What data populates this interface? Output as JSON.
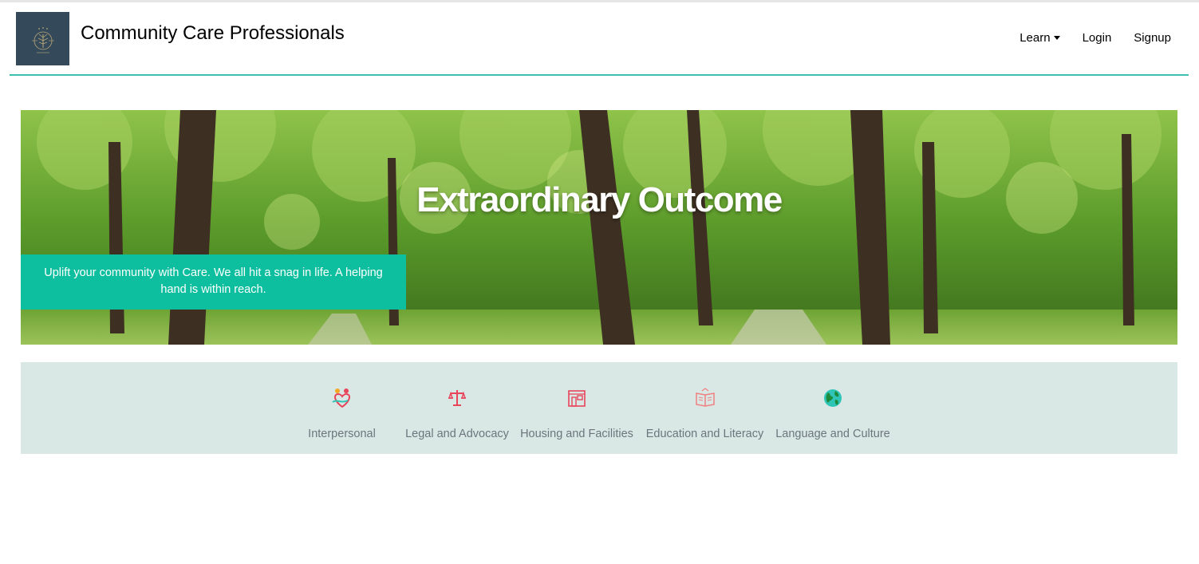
{
  "brand": {
    "name": "Community Care Professionals",
    "logo_icon": "tree-of-life-logo"
  },
  "nav": {
    "learn": "Learn",
    "login": "Login",
    "signup": "Signup"
  },
  "hero": {
    "title": "Extraordinary Outcome",
    "tagline": "Uplift your community with Care. We all hit a snag in life. A helping hand is within reach."
  },
  "categories": [
    {
      "label": "Interpersonal",
      "icon": "people-heart-icon"
    },
    {
      "label": "Legal and Advocacy",
      "icon": "scales-icon"
    },
    {
      "label": "Housing and Facilities",
      "icon": "house-icon"
    },
    {
      "label": "Education and Literacy",
      "icon": "open-book-icon"
    },
    {
      "label": "Language and Culture",
      "icon": "globe-icon"
    }
  ],
  "colors": {
    "accent": "#0dbe9f",
    "rule": "#3fbfae",
    "category_bg": "#dae8e5",
    "logo_bg": "#34495a"
  }
}
